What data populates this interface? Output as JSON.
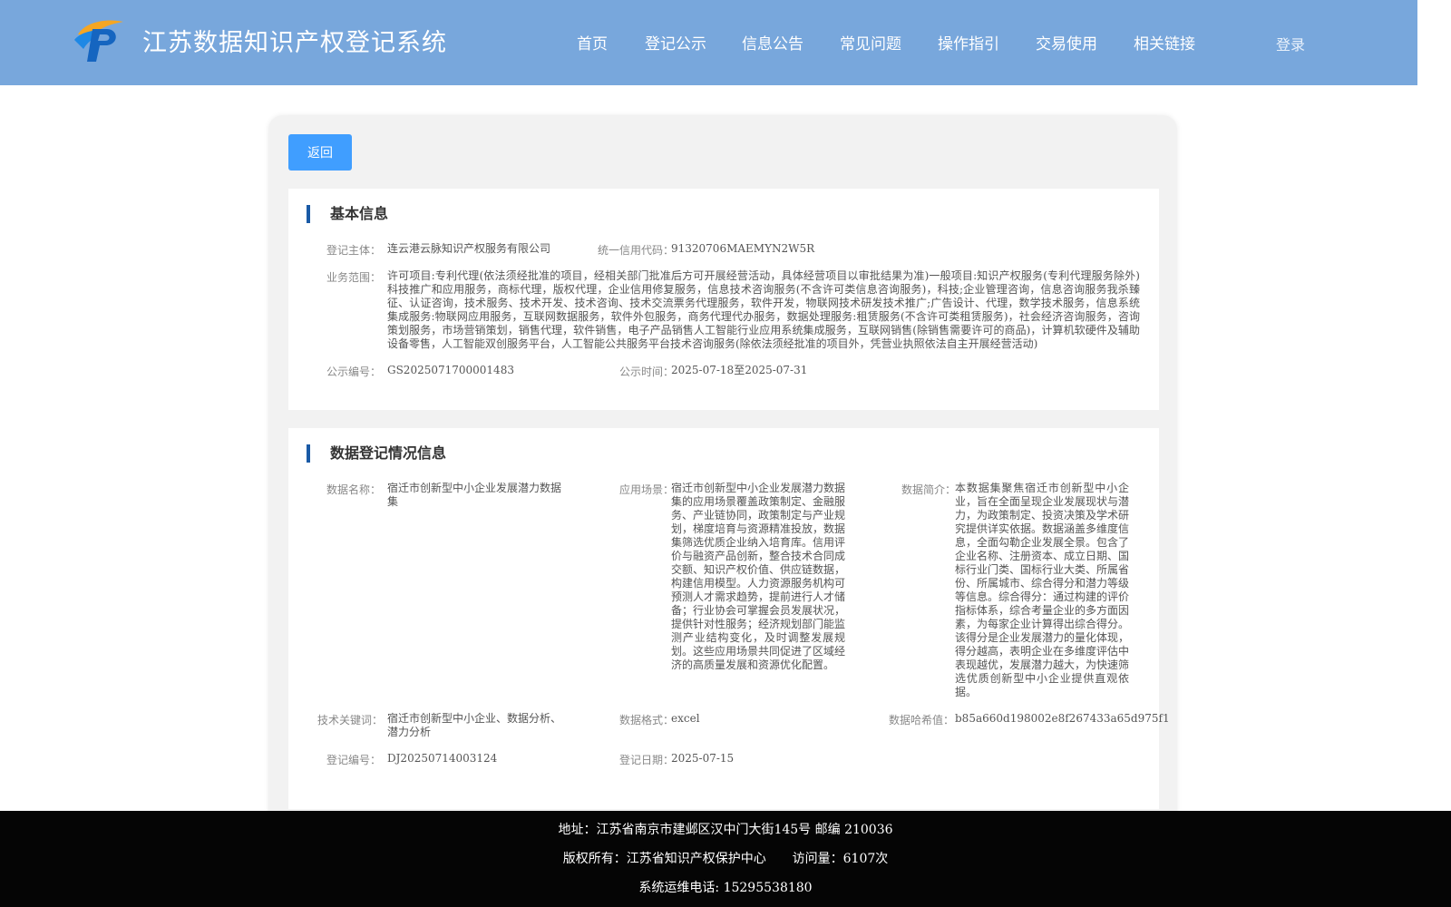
{
  "header": {
    "title": "江苏数据知识产权登记系统",
    "nav": [
      "首页",
      "登记公示",
      "信息公告",
      "常见问题",
      "操作指引",
      "交易使用",
      "相关链接"
    ],
    "login": "登录"
  },
  "back_label": "返回",
  "basic": {
    "title": "基本信息",
    "subject_label": "登记主体：",
    "subject": "连云港云脉知识产权服务有限公司",
    "credit_label": "统一信用代码：",
    "credit": "91320706MAEMYN2W5R",
    "scope_label": "业务范围：",
    "scope": "许可项目:专利代理(依法须经批准的项目，经相关部门批准后方可开展经营活动，具体经营项目以审批结果为准)一般项目:知识产权服务(专利代理服务除外)科技推广和应用服务，商标代理，版权代理，企业信用修复服务，信息技术咨询服务(不含许可类信息咨询服务)，科技;企业管理咨询，信息咨询服务我杀臻征、认证咨询，技术服务、技术开发、技术咨询、技术交流票务代理服务，软件开发，物联网技术研发技术推广;广告设计、代理，数学技术服务，信息系统集成服务:物联网应用服务，互联网数据服务，软件外包服务，商务代理代办服务，数据处理服务:租赁服务(不含许可类租赁服务)，社会经济咨询服务，咨询策划服务，市场营销策划，销售代理，软件销售，电子产品销售人工智能行业应用系统集成服务，互联网销售(除销售需要许可的商品)，计算机软硬件及辅助设备零售，人工智能双创服务平台，人工智能公共服务平台技术咨询服务(除依法须经批准的项目外，凭营业执照依法自主开展经营活动)",
    "pub_no_label": "公示编号：",
    "pub_no": "GS2025071700001483",
    "pub_time_label": "公示时间：",
    "pub_time": "2025-07-18至2025-07-31"
  },
  "reg": {
    "title": "数据登记情况信息",
    "name_label": "数据名称：",
    "name": "宿迁市创新型中小企业发展潜力数据集",
    "scene_label": "应用场景：",
    "scene": "宿迁市创新型中小企业发展潜力数据集的应用场景覆盖政策制定、金融服务、产业链协同，政策制定与产业规划，梯度培育与资源精准投放，数据集筛选优质企业纳入培育库。信用评价与融资产品创新，整合技术合同成交额、知识产权价值、供应链数据，构建信用模型。人力资源服务机构可预测人才需求趋势，提前进行人才储备；行业协会可掌握会员发展状况，提供针对性服务；经济规划部门能监测产业结构变化，及时调整发展规划。这些应用场景共同促进了区域经济的高质量发展和资源优化配置。",
    "intro_label": "数据简介：",
    "intro": "本数据集聚焦宿迁市创新型中小企业，旨在全面呈现企业发展现状与潜力，为政策制定、投资决策及学术研究提供详实依据。数据涵盖多维度信息，全面勾勒企业发展全景。包含了企业名称、注册资本、成立日期、国标行业门类、国标行业大类、所属省份、所属城市、综合得分和潜力等级等信息。综合得分：通过构建的评价指标体系，综合考量企业的多方面因素，为每家企业计算得出综合得分。该得分是企业发展潜力的量化体现，得分越高，表明企业在多维度评估中表现越优，发展潜力越大，为快速筛选优质创新型中小企业提供直观依据。",
    "keywords_label": "技术关键词：",
    "keywords": "宿迁市创新型中小企业、数据分析、潜力分析",
    "format_label": "数据格式：",
    "format": "excel",
    "hash_label": "数据哈希值：",
    "hash": "b85a660d198002e8f267433a65d975f1",
    "reg_no_label": "登记编号：",
    "reg_no": "DJ20250714003124",
    "reg_date_label": "登记日期：",
    "reg_date": "2025-07-15"
  },
  "footer": {
    "address": "地址：江苏省南京市建邺区汉中门大街145号 邮编 210036",
    "copyright": "版权所有：江苏省知识产权保护中心",
    "visits": "访问量：6107次",
    "phone": "系统运维电话: 15295538180"
  },
  "colors": {
    "header_bg": "#78a7dc",
    "button_bg": "#409eff",
    "accent_bar": "#1a5aa6",
    "footer_bg": "#050505"
  }
}
